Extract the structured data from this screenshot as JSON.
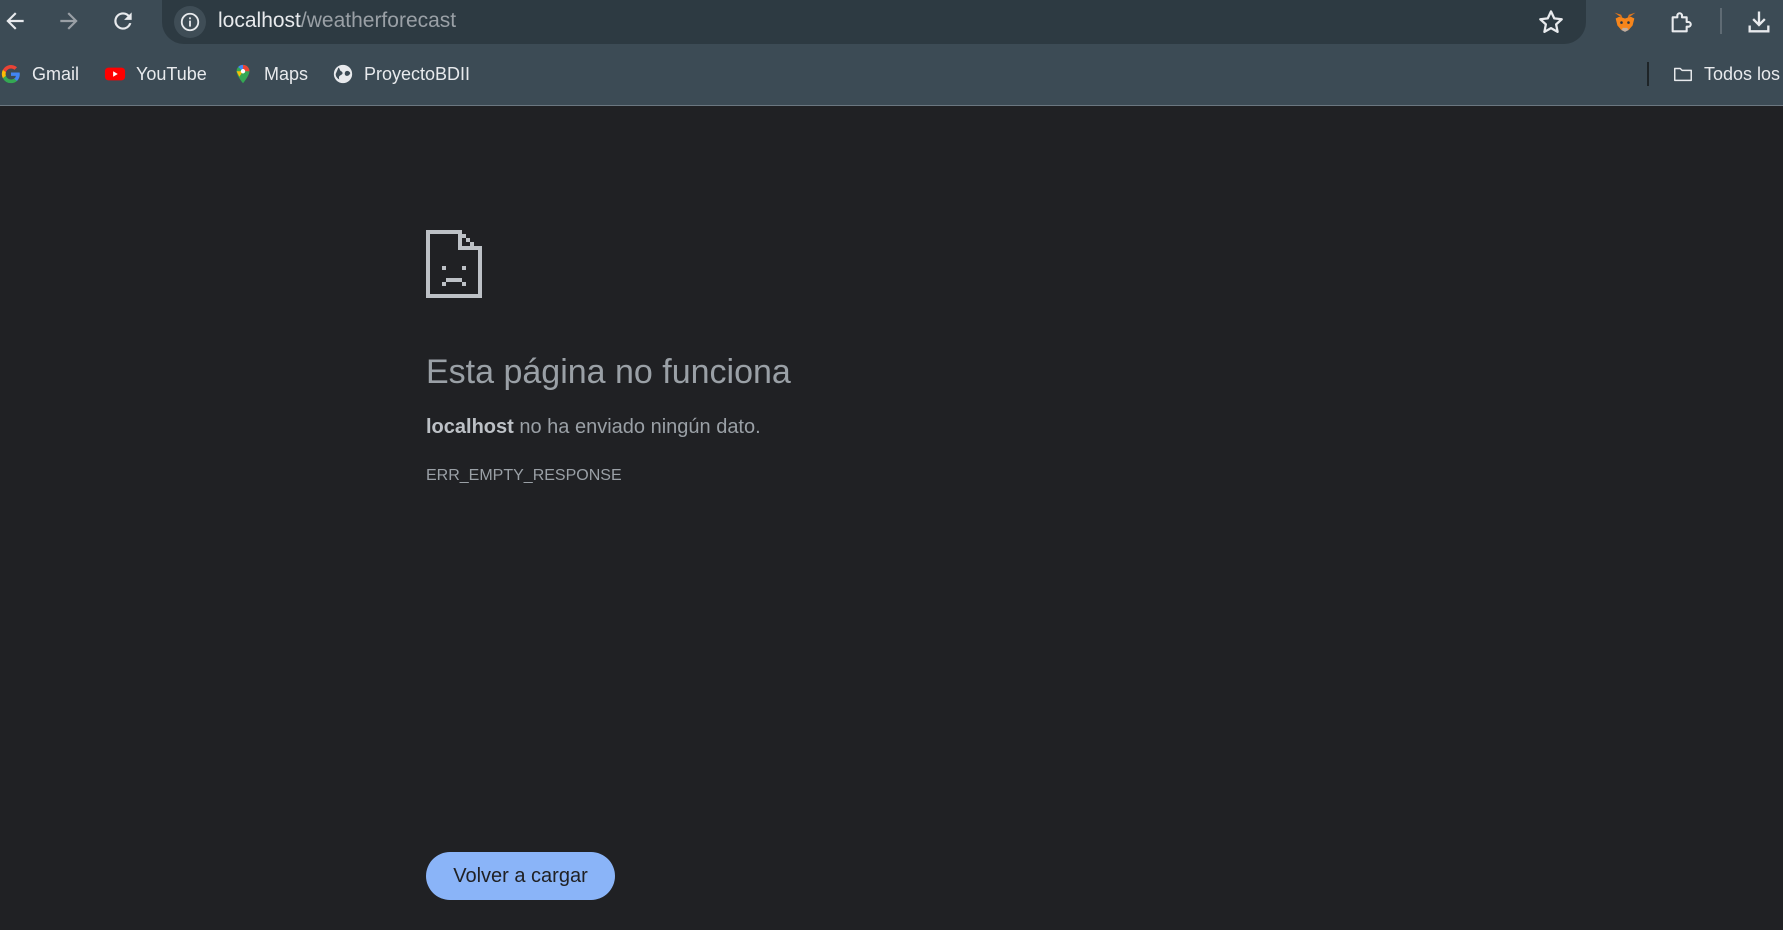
{
  "browser": {
    "url_host": "localhost",
    "url_path": "/weatherforecast",
    "toolbar_icons": [
      "back-icon",
      "forward-icon",
      "reload-icon",
      "site-info-icon",
      "bookmark-star-icon",
      "metamask-fox-icon",
      "extensions-puzzle-icon",
      "downloads-icon"
    ]
  },
  "bookmarks": {
    "items": [
      {
        "label": "Gmail",
        "icon": "google-g-icon"
      },
      {
        "label": "YouTube",
        "icon": "youtube-icon"
      },
      {
        "label": "Maps",
        "icon": "maps-pin-icon"
      },
      {
        "label": "ProyectoBDII",
        "icon": "globe-icon"
      }
    ],
    "all_bookmarks_label": "Todos los"
  },
  "error_page": {
    "title": "Esta página no funciona",
    "host": "localhost",
    "message": " no ha enviado ningún dato.",
    "code": "ERR_EMPTY_RESPONSE",
    "reload_label": "Volver a cargar"
  },
  "colors": {
    "page_background": "#202124",
    "toolbar_background": "#3c4b55",
    "button_accent": "#8ab4f8"
  }
}
